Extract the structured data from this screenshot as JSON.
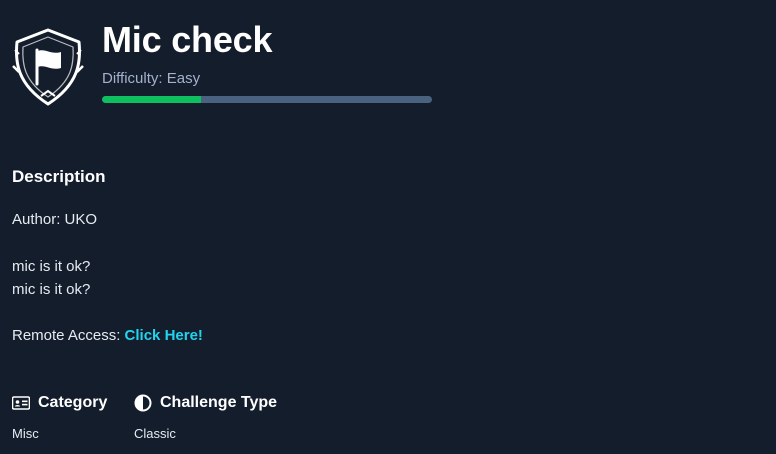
{
  "challenge": {
    "title": "Mic check",
    "difficulty_text": "Difficulty: Easy",
    "difficulty_progress_percent": 30,
    "icon": "flag-shield-icon"
  },
  "description": {
    "heading": "Description",
    "author_line": "Author: UKO",
    "text_line_1": "mic is it ok?",
    "text_line_2": "mic is it ok?",
    "remote_prefix": "Remote Access: ",
    "remote_link": "Click Here!"
  },
  "meta": {
    "category_label": "Category",
    "category_icon": "id-card-icon",
    "category_value": "Misc",
    "type_label": "Challenge Type",
    "type_icon": "half-circle-icon",
    "type_value": "Classic"
  },
  "colors": {
    "background": "#141d2b",
    "progress_fill": "#0fbf5f",
    "progress_track": "#4b6180",
    "link": "#22d3ee",
    "muted_text": "#a4b1cd"
  }
}
